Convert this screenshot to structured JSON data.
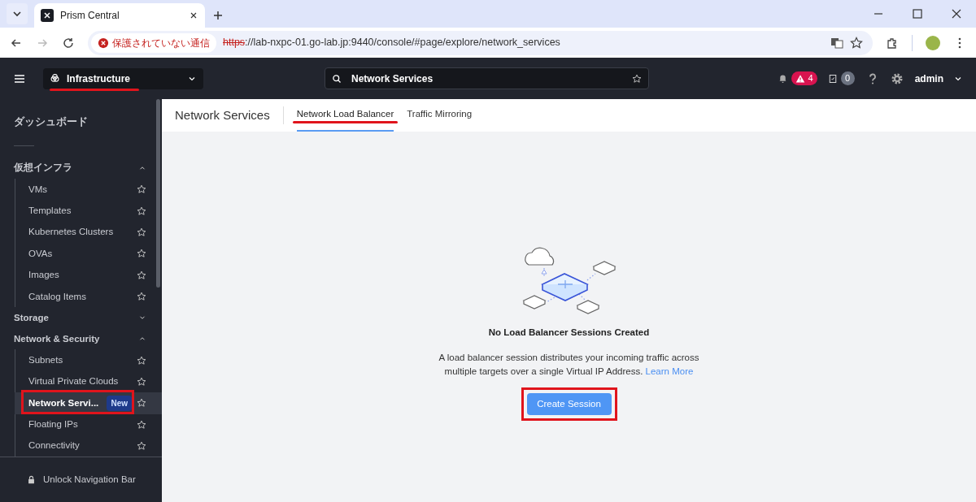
{
  "browser": {
    "tabs": [
      {
        "title": "Prism Central",
        "selected": true
      }
    ],
    "security_label": "保護されていない通信",
    "url_scheme": "https",
    "url_rest": "://lab-nxpc-01.go-lab.jp:9440/console/#page/explore/network_services"
  },
  "header": {
    "product": "Infrastructure",
    "product_underlined": true,
    "search": "Network Services",
    "alert_count": "4",
    "task_count": "0",
    "user": "admin"
  },
  "sidebar": {
    "sections": [
      {
        "label": "ダッシュボード",
        "kind": "link"
      },
      {
        "label": "仮想インフラ",
        "kind": "group",
        "expanded": true,
        "children": [
          {
            "label": "VMs",
            "selected": false,
            "highlighted": false
          },
          {
            "label": "Templates",
            "selected": false,
            "highlighted": false
          },
          {
            "label": "Kubernetes Clusters",
            "selected": false,
            "highlighted": false
          },
          {
            "label": "OVAs",
            "selected": false,
            "highlighted": false
          },
          {
            "label": "Images",
            "selected": false,
            "highlighted": false
          },
          {
            "label": "Catalog Items",
            "selected": false,
            "highlighted": false
          }
        ]
      },
      {
        "label": "Storage",
        "kind": "group",
        "expanded": false
      },
      {
        "label": "Network & Security",
        "kind": "group",
        "expanded": true,
        "children": [
          {
            "label": "Subnets",
            "selected": false,
            "highlighted": false
          },
          {
            "label": "Virtual Private Clouds",
            "selected": false,
            "highlighted": false
          },
          {
            "label": "Network Servi...",
            "badge": "New",
            "selected": true,
            "highlighted": true
          },
          {
            "label": "Floating IPs",
            "selected": false,
            "highlighted": false
          },
          {
            "label": "Connectivity",
            "selected": false,
            "highlighted": false
          }
        ]
      }
    ],
    "footer": "Unlock Navigation Bar"
  },
  "page": {
    "title": "Network Services",
    "tabs": [
      {
        "label": "Network Load Balancer",
        "selected": true,
        "underlined": true
      },
      {
        "label": "Traffic Mirroring",
        "selected": false,
        "underlined": false
      }
    ]
  },
  "empty_state": {
    "title": "No Load Balancer Sessions Created",
    "description": "A load balancer session distributes your incoming traffic across multiple targets over a single Virtual IP Address.",
    "link": "Learn More",
    "button": "Create Session",
    "button_highlighted": true
  }
}
